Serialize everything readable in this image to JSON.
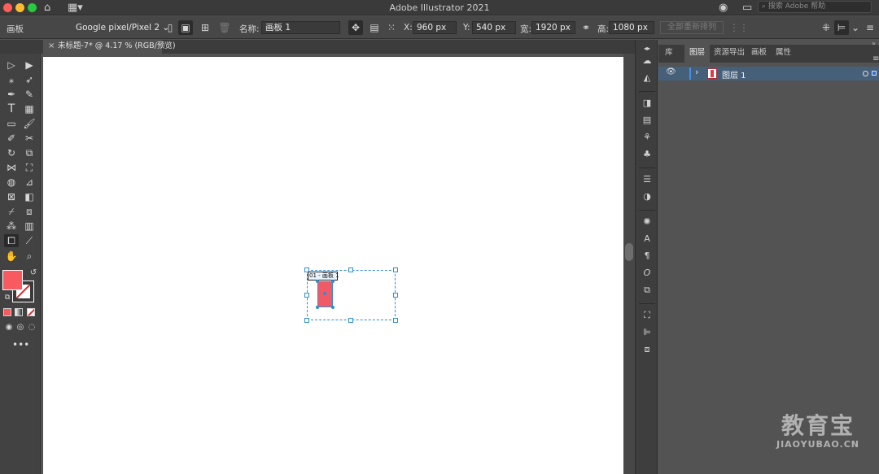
{
  "window": {
    "title": "Adobe Illustrator 2021",
    "search_placeholder": "搜索 Adobe 帮助"
  },
  "control_bar": {
    "panel_label": "画板",
    "preset": "Google pixel/Pixel 2",
    "name_label": "名称:",
    "name_value": "画板 1",
    "x_label": "X:",
    "x_value": "960 px",
    "y_label": "Y:",
    "y_value": "540 px",
    "width_label": "宽:",
    "width_value": "1920 px",
    "height_label": "高:",
    "height_value": "1080 px",
    "rearrange_all": "全部重新排列"
  },
  "document": {
    "tab_title": "未标题-7* @ 4.17 % (RGB/预览)",
    "tab_close": "×",
    "artboard_label": "01 - 画板 1"
  },
  "toolbar": {
    "fill_color": "#f85a5f",
    "stroke_indicator": "none",
    "more_tools": "•••"
  },
  "right_panel": {
    "tabs": [
      {
        "label": "库",
        "active": false
      },
      {
        "label": "图层",
        "active": true
      },
      {
        "label": "资源导出",
        "active": false
      },
      {
        "label": "画板",
        "active": false
      },
      {
        "label": "属性",
        "active": false
      }
    ],
    "layers": [
      {
        "name": "图层 1",
        "visible": true,
        "selected": true
      }
    ]
  },
  "watermark": {
    "text": "教育宝",
    "url": "JIAOYUBAO.CN"
  }
}
